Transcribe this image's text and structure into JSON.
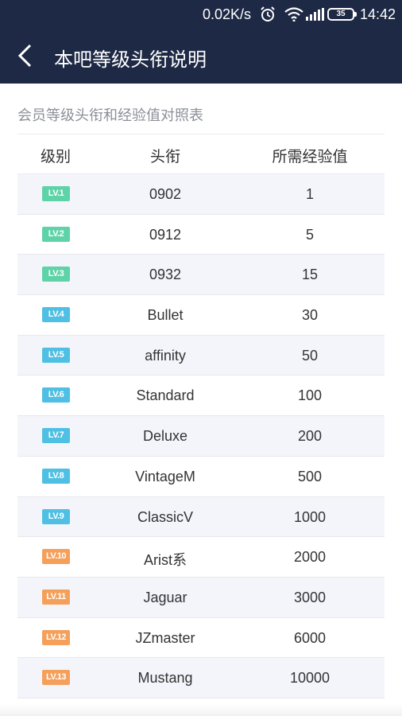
{
  "status_bar": {
    "speed": "0.02K/s",
    "battery": "35",
    "time": "14:42"
  },
  "header": {
    "title": "本吧等级头衔说明"
  },
  "subtitle": "会员等级头衔和经验值对照表",
  "table": {
    "headers": [
      "级别",
      "头衔",
      "所需经验值"
    ],
    "rows": [
      {
        "level": "LV.1",
        "title": "0902",
        "exp": "1",
        "color": "#5fd3a8"
      },
      {
        "level": "LV.2",
        "title": "0912",
        "exp": "5",
        "color": "#5fd3a8"
      },
      {
        "level": "LV.3",
        "title": "0932",
        "exp": "15",
        "color": "#5fd3a8"
      },
      {
        "level": "LV.4",
        "title": "Bullet",
        "exp": "30",
        "color": "#4fc0e3"
      },
      {
        "level": "LV.5",
        "title": "affinity",
        "exp": "50",
        "color": "#4fc0e3"
      },
      {
        "level": "LV.6",
        "title": "Standard",
        "exp": "100",
        "color": "#4fc0e3"
      },
      {
        "level": "LV.7",
        "title": "Deluxe",
        "exp": "200",
        "color": "#4fc0e3"
      },
      {
        "level": "LV.8",
        "title": "VintageM",
        "exp": "500",
        "color": "#4fc0e3"
      },
      {
        "level": "LV.9",
        "title": "ClassicV",
        "exp": "1000",
        "color": "#4fc0e3"
      },
      {
        "level": "LV.10",
        "title": "Arist系",
        "exp": "2000",
        "color": "#f5a05a"
      },
      {
        "level": "LV.11",
        "title": "Jaguar",
        "exp": "3000",
        "color": "#f5a05a"
      },
      {
        "level": "LV.12",
        "title": "JZmaster",
        "exp": "6000",
        "color": "#f5a05a"
      },
      {
        "level": "LV.13",
        "title": "Mustang",
        "exp": "10000",
        "color": "#f5a05a"
      }
    ]
  },
  "icons": [
    "back-arrow-icon",
    "alarm-icon",
    "wifi-icon",
    "signal-icon",
    "battery-icon"
  ]
}
